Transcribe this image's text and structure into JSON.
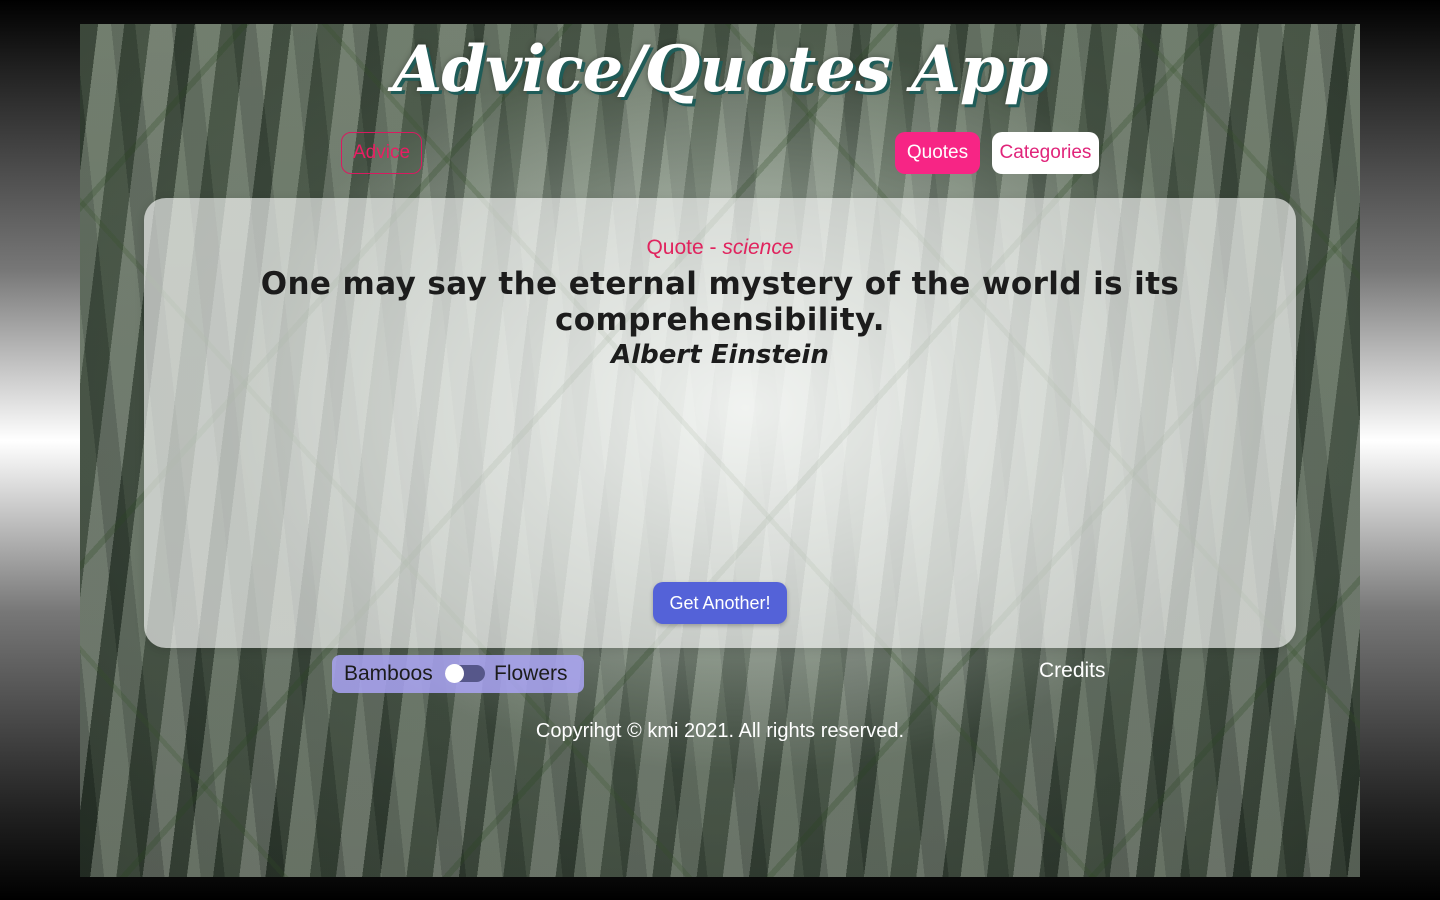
{
  "app": {
    "title": "Advice/Quotes App"
  },
  "nav": {
    "advice_label": "Advice",
    "quotes_label": "Quotes",
    "categories_label": "Categories"
  },
  "quote": {
    "type_label": "Quote - ",
    "category": "science",
    "text": "One may say the eternal mystery of the world is its comprehensibility.",
    "author": "Albert Einstein"
  },
  "actions": {
    "get_another_label": "Get Another!"
  },
  "background_toggle": {
    "left_label": "Bamboos",
    "right_label": "Flowers",
    "selected": "Bamboos"
  },
  "footer": {
    "credits_label": "Credits",
    "copyright": "Copyrihgt © kmi 2021. All rights reserved."
  },
  "colors": {
    "accent_pink": "#f72585",
    "button_blue": "#5462d8",
    "title_shadow": "#1f5c58",
    "toggle_bg": "#aaa5f5"
  }
}
